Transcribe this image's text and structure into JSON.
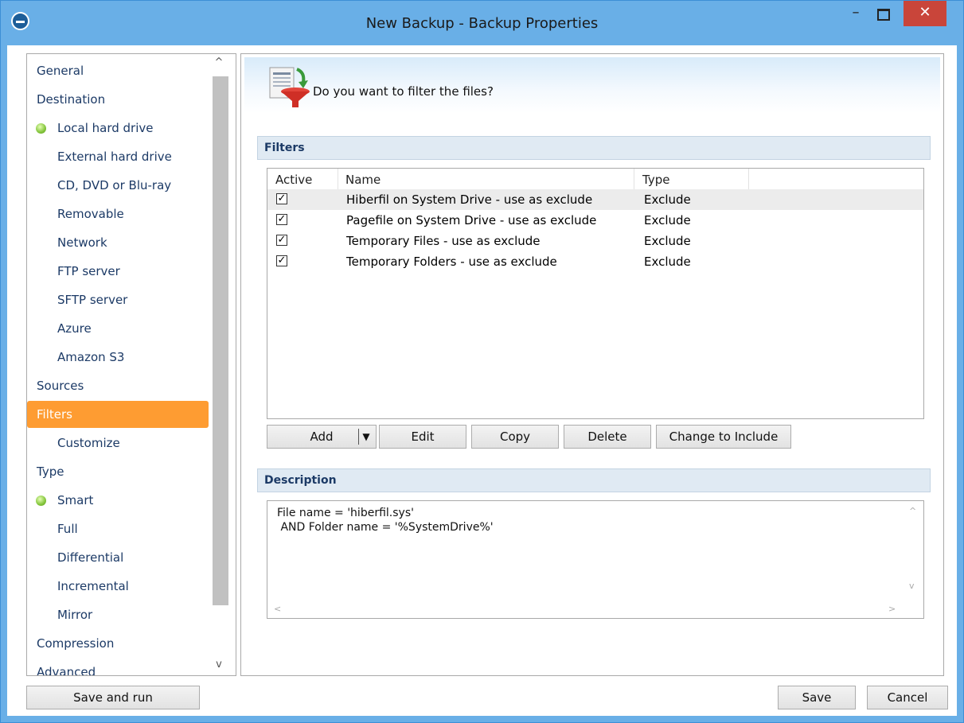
{
  "window": {
    "title": "New Backup - Backup Properties",
    "minimize": "–",
    "close": "✕"
  },
  "sidebar": {
    "items": [
      {
        "label": "General",
        "level": 0,
        "dot": false,
        "selected": false
      },
      {
        "label": "Destination",
        "level": 0,
        "dot": false,
        "selected": false
      },
      {
        "label": "Local hard drive",
        "level": 1,
        "dot": true,
        "selected": false
      },
      {
        "label": "External hard drive",
        "level": 1,
        "dot": false,
        "selected": false
      },
      {
        "label": "CD, DVD or Blu-ray",
        "level": 1,
        "dot": false,
        "selected": false
      },
      {
        "label": "Removable",
        "level": 1,
        "dot": false,
        "selected": false
      },
      {
        "label": "Network",
        "level": 1,
        "dot": false,
        "selected": false
      },
      {
        "label": "FTP server",
        "level": 1,
        "dot": false,
        "selected": false
      },
      {
        "label": "SFTP server",
        "level": 1,
        "dot": false,
        "selected": false
      },
      {
        "label": "Azure",
        "level": 1,
        "dot": false,
        "selected": false
      },
      {
        "label": "Amazon S3",
        "level": 1,
        "dot": false,
        "selected": false
      },
      {
        "label": "Sources",
        "level": 0,
        "dot": false,
        "selected": false
      },
      {
        "label": "Filters",
        "level": 0,
        "dot": false,
        "selected": true
      },
      {
        "label": "Customize",
        "level": 1,
        "dot": false,
        "selected": false
      },
      {
        "label": "Type",
        "level": 0,
        "dot": false,
        "selected": false
      },
      {
        "label": "Smart",
        "level": 1,
        "dot": true,
        "selected": false
      },
      {
        "label": "Full",
        "level": 1,
        "dot": false,
        "selected": false
      },
      {
        "label": "Differential",
        "level": 1,
        "dot": false,
        "selected": false
      },
      {
        "label": "Incremental",
        "level": 1,
        "dot": false,
        "selected": false
      },
      {
        "label": "Mirror",
        "level": 1,
        "dot": false,
        "selected": false
      },
      {
        "label": "Compression",
        "level": 0,
        "dot": false,
        "selected": false
      },
      {
        "label": "Advanced",
        "level": 0,
        "dot": false,
        "selected": false
      }
    ]
  },
  "banner": {
    "question": "Do you want to filter the files?",
    "icon": "filter-funnel-icon"
  },
  "filters": {
    "header": "Filters",
    "columns": [
      "Active",
      "Name",
      "Type"
    ],
    "rows": [
      {
        "active": true,
        "name": "Hiberfil on System Drive - use as exclude",
        "type": "Exclude"
      },
      {
        "active": true,
        "name": "Pagefile on System Drive - use as exclude",
        "type": "Exclude"
      },
      {
        "active": true,
        "name": "Temporary Files - use as exclude",
        "type": "Exclude"
      },
      {
        "active": true,
        "name": "Temporary Folders - use as exclude",
        "type": "Exclude"
      }
    ],
    "buttons": {
      "add": "Add",
      "edit": "Edit",
      "copy": "Copy",
      "delete": "Delete",
      "change": "Change to Include"
    }
  },
  "description": {
    "header": "Description",
    "line1": "File name = 'hiberfil.sys'",
    "line2": " AND Folder name = '%SystemDrive%'"
  },
  "footer": {
    "save_and_run": "Save and run",
    "save": "Save",
    "cancel": "Cancel"
  },
  "colors": {
    "accent_selected": "#fe9c32",
    "title_bar": "#69afe7",
    "close_button": "#c9453a",
    "section_header": "#e0eaf3",
    "nav_text": "#1c3a66"
  }
}
